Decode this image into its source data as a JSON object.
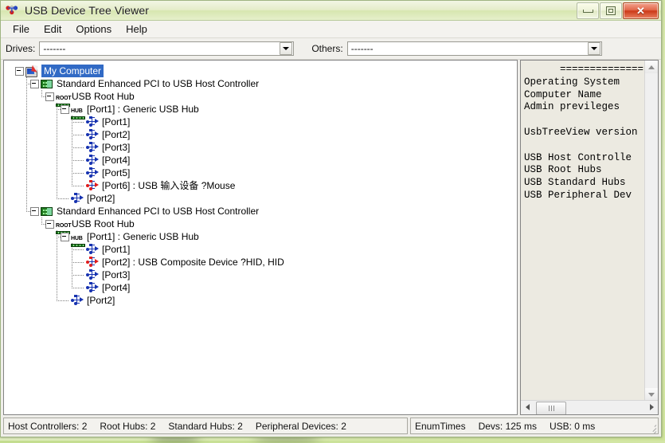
{
  "window": {
    "title": "USB Device Tree Viewer",
    "icon": "usb-logo-icon",
    "buttons": {
      "minimize": "minimize-button",
      "maximize": "maximize-button",
      "close": "✕"
    }
  },
  "menu": {
    "items": [
      {
        "label": "File"
      },
      {
        "label": "Edit"
      },
      {
        "label": "Options"
      },
      {
        "label": "Help"
      }
    ]
  },
  "toolbar": {
    "drives_label": "Drives:",
    "drives_value": "-------",
    "others_label": "Others:",
    "others_value": "-------"
  },
  "tree": {
    "nodes": [
      {
        "id": "n0",
        "depth": 0,
        "label": "My Computer",
        "icon": "my-computer-icon",
        "expander": "minus",
        "selected": true
      },
      {
        "id": "n1",
        "depth": 1,
        "label": "Standard Enhanced PCI to USB Host Controller",
        "icon": "host-controller-icon",
        "expander": "minus",
        "selected": false
      },
      {
        "id": "n2",
        "depth": 2,
        "label": "USB Root Hub",
        "icon": "root-hub-icon",
        "expander": "minus",
        "selected": false
      },
      {
        "id": "n3",
        "depth": 3,
        "label": "[Port1] : Generic USB Hub",
        "icon": "standard-hub-icon",
        "expander": "minus",
        "selected": false
      },
      {
        "id": "n4",
        "depth": 4,
        "label": "[Port1]",
        "icon": "usb-port-empty-icon",
        "expander": "none",
        "selected": false
      },
      {
        "id": "n5",
        "depth": 4,
        "label": "[Port2]",
        "icon": "usb-port-empty-icon",
        "expander": "none",
        "selected": false
      },
      {
        "id": "n6",
        "depth": 4,
        "label": "[Port3]",
        "icon": "usb-port-empty-icon",
        "expander": "none",
        "selected": false
      },
      {
        "id": "n7",
        "depth": 4,
        "label": "[Port4]",
        "icon": "usb-port-empty-icon",
        "expander": "none",
        "selected": false
      },
      {
        "id": "n8",
        "depth": 4,
        "label": "[Port5]",
        "icon": "usb-port-empty-icon",
        "expander": "none",
        "selected": false
      },
      {
        "id": "n9",
        "depth": 4,
        "label": "[Port6] : USB 输入设备  ?Mouse",
        "icon": "usb-port-connected-icon",
        "expander": "none",
        "selected": false
      },
      {
        "id": "n10",
        "depth": 3,
        "label": "[Port2]",
        "icon": "usb-port-empty-icon",
        "expander": "none",
        "selected": false
      },
      {
        "id": "n11",
        "depth": 1,
        "label": "Standard Enhanced PCI to USB Host Controller",
        "icon": "host-controller-icon",
        "expander": "minus",
        "selected": false
      },
      {
        "id": "n12",
        "depth": 2,
        "label": "USB Root Hub",
        "icon": "root-hub-icon",
        "expander": "minus",
        "selected": false
      },
      {
        "id": "n13",
        "depth": 3,
        "label": "[Port1] : Generic USB Hub",
        "icon": "standard-hub-icon",
        "expander": "minus",
        "selected": false
      },
      {
        "id": "n14",
        "depth": 4,
        "label": "[Port1]",
        "icon": "usb-port-empty-icon",
        "expander": "none",
        "selected": false
      },
      {
        "id": "n15",
        "depth": 4,
        "label": "[Port2] : USB Composite Device  ?HID, HID",
        "icon": "usb-port-connected-icon",
        "expander": "none",
        "selected": false
      },
      {
        "id": "n16",
        "depth": 4,
        "label": "[Port3]",
        "icon": "usb-port-empty-icon",
        "expander": "none",
        "selected": false
      },
      {
        "id": "n17",
        "depth": 4,
        "label": "[Port4]",
        "icon": "usb-port-empty-icon",
        "expander": "none",
        "selected": false
      },
      {
        "id": "n18",
        "depth": 3,
        "label": "[Port2]",
        "icon": "usb-port-empty-icon",
        "expander": "none",
        "selected": false
      }
    ],
    "icon_captions": {
      "root_hub": "ROOT",
      "standard_hub": "HUB"
    }
  },
  "info_panel": {
    "text": "      ==============\nOperating System\nComputer Name\nAdmin previleges\n\nUsbTreeView version\n\nUSB Host Controlle\nUSB Root Hubs\nUSB Standard Hubs\nUSB Peripheral Dev"
  },
  "statusbar": {
    "left": [
      "Host Controllers: 2",
      "Root Hubs: 2",
      "Standard Hubs: 2",
      "Peripheral Devices: 2"
    ],
    "right": [
      "EnumTimes",
      "Devs: 125 ms",
      "USB: 0 ms"
    ]
  },
  "colors": {
    "selection": "#316ac5",
    "usb_blue": "#1632b0",
    "usb_red": "#e01b1b",
    "hub_green": "#1f7a1f",
    "desktop": "#cfe49b"
  }
}
